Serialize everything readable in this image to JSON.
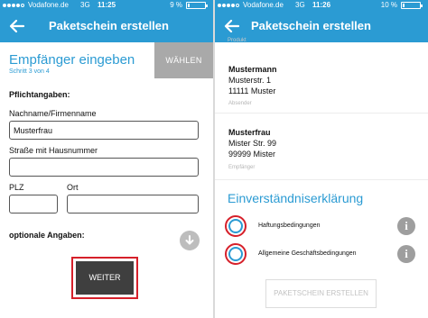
{
  "left": {
    "status": {
      "carrier": "Vodafone.de",
      "network": "3G",
      "time": "11:25",
      "battery": "9 %",
      "battery_level": 0.09
    },
    "appbar": {
      "title": "Paketschein erstellen"
    },
    "heading": "Empfänger eingeben",
    "step": "Schritt 3 von 4",
    "choose_label": "WÄHLEN",
    "required_title": "Pflichtangaben:",
    "fields": {
      "name": {
        "label": "Nachname/Firmenname",
        "value": "Musterfrau"
      },
      "street": {
        "label": "Straße mit Hausnummer",
        "value": ""
      },
      "zip": {
        "label": "PLZ",
        "value": ""
      },
      "city": {
        "label": "Ort",
        "value": ""
      }
    },
    "optional_title": "optionale Angaben:",
    "next_label": "WEITER"
  },
  "right": {
    "status": {
      "carrier": "Vodafone.de",
      "network": "3G",
      "time": "11:26",
      "battery": "10 %",
      "battery_level": 0.1
    },
    "appbar": {
      "title": "Paketschein erstellen"
    },
    "cut_label": "Produkt",
    "sender": {
      "name": "Mustermann",
      "street": "Musterstr. 1",
      "city": "11111 Muster",
      "caption": "Absender"
    },
    "recipient": {
      "name": "Musterfrau",
      "street": "Mister Str. 99",
      "city": "99999 Mister",
      "caption": "Empfänger"
    },
    "consent_title": "Einverständniserklärung",
    "consents": [
      {
        "label": "Haftungsbedingungen"
      },
      {
        "label": "Allgemeine Geschäftsbedingungen"
      }
    ],
    "info_glyph": "i",
    "create_label": "PAKETSCHEIN ERSTELLEN"
  },
  "colors": {
    "brand": "#2b9bd3",
    "highlight": "#d6202a",
    "button_dark": "#3f3f3f"
  }
}
